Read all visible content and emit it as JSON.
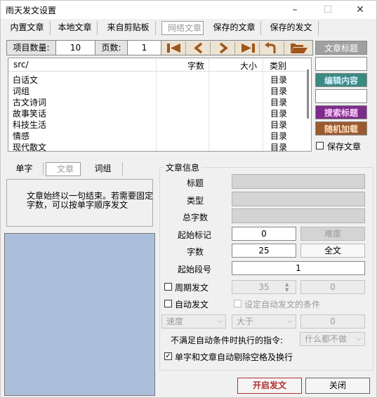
{
  "window": {
    "title": "雨天发文设置",
    "minimize": "–",
    "maximize": "☐",
    "close": "✕"
  },
  "tabs": [
    {
      "label": "内置文章"
    },
    {
      "label": "本地文章"
    },
    {
      "label": "来自剪贴板"
    },
    {
      "label": "网络文章"
    },
    {
      "label": "保存的文章"
    },
    {
      "label": "保存的发文"
    }
  ],
  "toolbar": {
    "count_label": "项目数量:",
    "count_value": "10",
    "pages_label": "页数:",
    "pages_value": "1"
  },
  "list": {
    "columns": [
      "src/",
      "字数",
      "大小",
      "类别"
    ],
    "rows": [
      {
        "name": "白话文",
        "type": "目录"
      },
      {
        "name": "词组",
        "type": "目录"
      },
      {
        "name": "古文诗词",
        "type": "目录"
      },
      {
        "name": "故事笑话",
        "type": "目录"
      },
      {
        "name": "科技生活",
        "type": "目录"
      },
      {
        "name": "情感",
        "type": "目录"
      },
      {
        "name": "现代散文",
        "type": "目录"
      }
    ]
  },
  "right_panel": {
    "title_button": "文章标题",
    "edit_button": "编辑内容",
    "search_button": "搜索标题",
    "random_button": "随机加载",
    "save_label": "保存文章"
  },
  "left_tabs": [
    {
      "label": "单字"
    },
    {
      "label": "文章"
    },
    {
      "label": "词组"
    }
  ],
  "message": "文章始终以一句结束。若需要固定字数，可以按单字顺序发文",
  "info": {
    "group_title": "文章信息",
    "title_label": "标题",
    "type_label": "类型",
    "total_label": "总字数",
    "start_mark_label": "起始标记",
    "start_mark_value": "0",
    "difficulty_button": "难度",
    "chars_label": "字数",
    "chars_value": "25",
    "fulltext_button": "全文",
    "start_para_label": "起始段号",
    "start_para_value": "1",
    "periodic_label": "周期发文",
    "periodic_value": "35",
    "periodic_extra": "0",
    "auto_label": "自动发文",
    "auto_cond_label": "设定自动发文的条件",
    "speed_select": "速度",
    "greater_select": "大于",
    "cond_value": "0",
    "not_met_label": "不满足自动条件时执行的指令:",
    "nothing_select": "什么都不做",
    "strip_label": "单字和文章自动剔除空格及换行"
  },
  "bottom": {
    "start_button": "开启发文",
    "close_button": "关闭"
  },
  "colors": {
    "nav_bg": "#ece3d2",
    "nav_icon": "#a0561a",
    "title_btn_bg": "#a0a0a0",
    "edit_btn_bg": "#3a8a82",
    "search_btn_bg": "#7e2c8a",
    "random_btn_bg": "#9a5a30",
    "blue_box": "#abbfdb",
    "start_border": "#b03030"
  }
}
